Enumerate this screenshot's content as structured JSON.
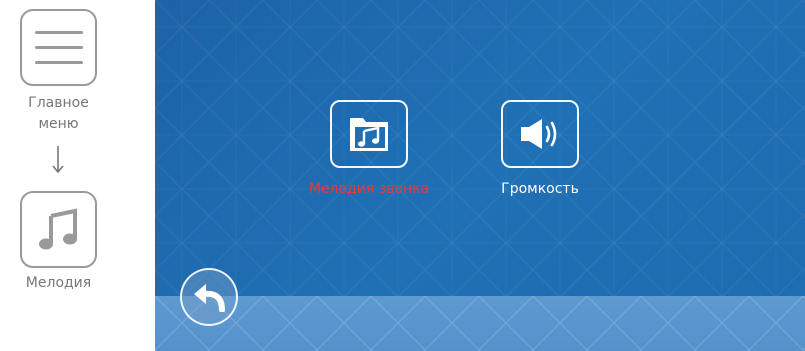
{
  "guide": {
    "menu_label": "Главное меню",
    "menu_icon": "hamburger-icon",
    "melody_label": "Мелодия",
    "melody_icon": "music-note-icon"
  },
  "screen": {
    "items": [
      {
        "label": "Мелодия звонка",
        "icon": "music-folder-icon",
        "selected": true
      },
      {
        "label": "Громкость",
        "icon": "speaker-volume-icon",
        "selected": false
      }
    ],
    "back_icon": "back-arrow-icon",
    "colors": {
      "background": "#1e6bb0",
      "band": "#5a97d0",
      "selected_label": "#e03c3c",
      "label": "#ffffff"
    }
  }
}
